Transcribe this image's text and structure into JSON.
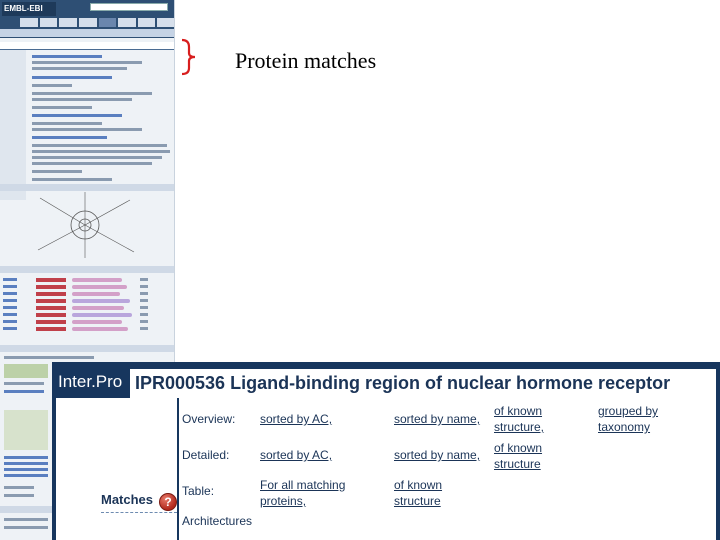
{
  "thumbnail": {
    "logo_text": "EMBL-EBI"
  },
  "callout": {
    "label": "Protein matches"
  },
  "panel": {
    "interpro_label": "Inter.Pro",
    "entry_heading": "IPR000536 Ligand-binding region of nuclear hormone receptor",
    "matches_label": "Matches",
    "help_glyph": "?",
    "rows": {
      "overview": {
        "label": "Overview:",
        "sorted_by_ac": "sorted by AC,",
        "sorted_by_name": "sorted by name,",
        "of_known_structure_1": "of known",
        "of_known_structure_2": "structure,",
        "grouped_by_taxonomy_1": "grouped by",
        "grouped_by_taxonomy_2": "taxonomy"
      },
      "detailed": {
        "label": "Detailed:",
        "sorted_by_ac": "sorted by AC,",
        "sorted_by_name": "sorted by name,",
        "of_known_structure_1": "of known",
        "of_known_structure_2": "structure"
      },
      "table": {
        "label": "Table:",
        "all_matching_1": "For all matching",
        "all_matching_2": "proteins,",
        "of_known_structure_1": "of known",
        "of_known_structure_2": "structure"
      },
      "architectures": {
        "label": "Architectures"
      }
    }
  },
  "colors": {
    "panel_background": "#17365e",
    "heading_text": "#1b3457",
    "brace": "#d81e1e",
    "help_icon": "#b2281c"
  }
}
